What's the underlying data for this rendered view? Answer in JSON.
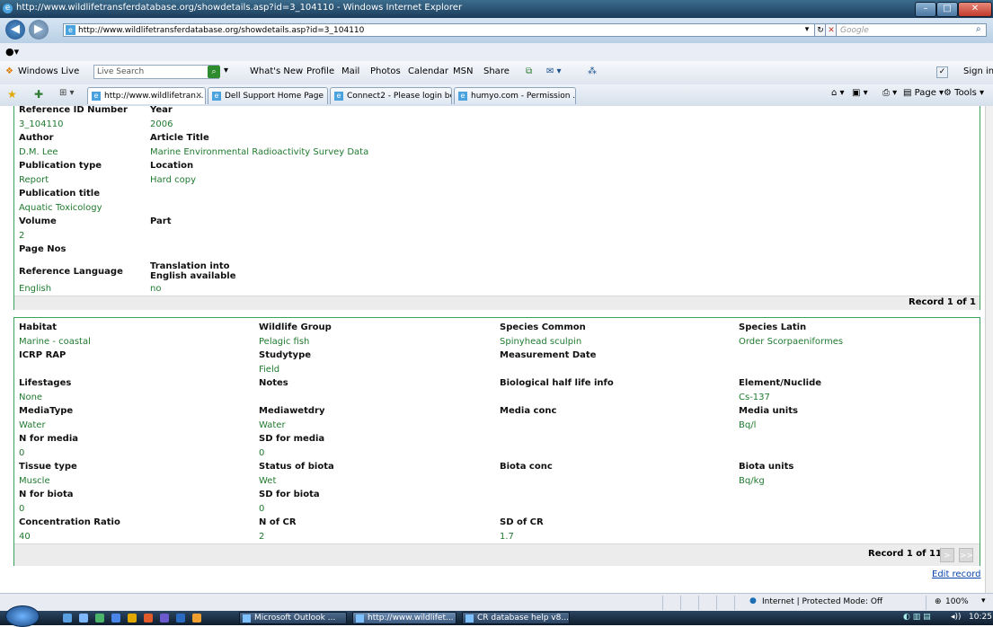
{
  "window": {
    "title": "http://www.wildlifetransferdatabase.org/showdetails.asp?id=3_104110 - Windows Internet Explorer"
  },
  "address": {
    "url": "http://www.wildlifetransferdatabase.org/showdetails.asp?id=3_104110",
    "search_placeholder": "Google"
  },
  "links_bar": {
    "windows_live": "Windows Live",
    "live_search_placeholder": "Live Search",
    "items": [
      "What's New",
      "Profile",
      "Mail",
      "Photos",
      "Calendar",
      "MSN",
      "Share"
    ],
    "sign_in": "Sign in"
  },
  "tabs": [
    {
      "label": "http://www.wildlifetran...",
      "active": true
    },
    {
      "label": "Dell Support Home Page",
      "active": false
    },
    {
      "label": "Connect2 - Please login be...",
      "active": false
    },
    {
      "label": "humyo.com - Permission ...",
      "active": false
    }
  ],
  "command_bar": {
    "page": "Page",
    "tools": "Tools"
  },
  "reference": {
    "fields": [
      {
        "label": "Reference ID Number",
        "value": "3_104110"
      },
      {
        "label": "Year",
        "value": "2006"
      },
      {
        "label": "Author",
        "value": "D.M. Lee"
      },
      {
        "label": "Article Title",
        "value": "Marine Environmental Radioactivity Survey Data"
      },
      {
        "label": "Publication type",
        "value": "Report"
      },
      {
        "label": "Location",
        "value": "Hard copy"
      },
      {
        "label": "Publication title",
        "value": "Aquatic Toxicology"
      },
      {
        "label": "Volume",
        "value": "2"
      },
      {
        "label": "Part",
        "value": ""
      },
      {
        "label": "Page Nos",
        "value": ""
      },
      {
        "label": "Reference Language",
        "value": "English"
      },
      {
        "label": "Translation into English available",
        "value": "no"
      }
    ],
    "record_text": "Record 1 of 1"
  },
  "details": {
    "rows": [
      [
        {
          "label": "Habitat",
          "value": "Marine - coastal"
        },
        {
          "label": "Wildlife Group",
          "value": "Pelagic fish"
        },
        {
          "label": "Species Common",
          "value": "Spinyhead sculpin"
        },
        {
          "label": "Species Latin",
          "value": "Order Scorpaeniformes"
        }
      ],
      [
        {
          "label": "ICRP RAP",
          "value": ""
        },
        {
          "label": "Studytype",
          "value": "Field"
        },
        {
          "label": "Measurement Date",
          "value": ""
        },
        {
          "label": "",
          "value": ""
        }
      ],
      [
        {
          "label": "Lifestages",
          "value": "None"
        },
        {
          "label": "Notes",
          "value": ""
        },
        {
          "label": "Biological half life info",
          "value": ""
        },
        {
          "label": "Element/Nuclide",
          "value": "Cs-137"
        }
      ],
      [
        {
          "label": "MediaType",
          "value": "Water"
        },
        {
          "label": "Mediawetdry",
          "value": "Water"
        },
        {
          "label": "Media conc",
          "value": ""
        },
        {
          "label": "Media units",
          "value": "Bq/l"
        }
      ],
      [
        {
          "label": "N for media",
          "value": "0"
        },
        {
          "label": "SD for media",
          "value": "0"
        },
        {
          "label": "",
          "value": ""
        },
        {
          "label": "",
          "value": ""
        }
      ],
      [
        {
          "label": "Tissue type",
          "value": "Muscle"
        },
        {
          "label": "Status of biota",
          "value": "Wet"
        },
        {
          "label": "Biota conc",
          "value": ""
        },
        {
          "label": "Biota units",
          "value": "Bq/kg"
        }
      ],
      [
        {
          "label": "N for biota",
          "value": "0"
        },
        {
          "label": "SD for biota",
          "value": "0"
        },
        {
          "label": "",
          "value": ""
        },
        {
          "label": "",
          "value": ""
        }
      ],
      [
        {
          "label": "Concentration Ratio",
          "value": "40"
        },
        {
          "label": "N of CR",
          "value": "2"
        },
        {
          "label": "SD of CR",
          "value": "1.7"
        },
        {
          "label": "",
          "value": ""
        }
      ]
    ],
    "record_text": "Record 1 of 11",
    "next_label": ">",
    "last_label": ">>",
    "edit_record": "Edit record"
  },
  "status": {
    "zone": "Internet | Protected Mode: Off",
    "zoom": "100%"
  },
  "taskbar": {
    "tasks": [
      "Microsoft Outlook ...",
      "http://www.wildlifet...",
      "CR database help v8..."
    ],
    "clock": "10:25"
  },
  "colors": {
    "panel_border": "#3aa35a",
    "value_text": "#1f7a2e",
    "link": "#0645ad"
  }
}
